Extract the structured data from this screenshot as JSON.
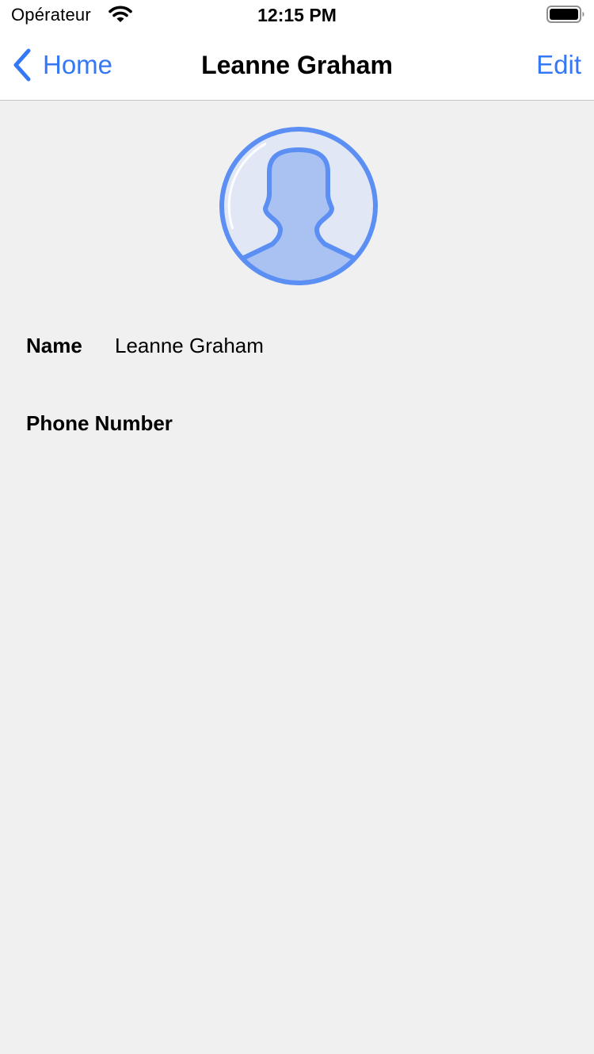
{
  "status_bar": {
    "carrier": "Opérateur",
    "time": "12:15 PM"
  },
  "nav": {
    "back_label": "Home",
    "title": "Leanne Graham",
    "edit_label": "Edit"
  },
  "contact": {
    "name_label": "Name",
    "name_value": "Leanne Graham",
    "phone_label": "Phone Number",
    "phone_value": ""
  },
  "colors": {
    "accent": "#3478f6",
    "background": "#f0f0f0",
    "avatar_ring": "#5b8ff3",
    "avatar_fill": "#e1e7f4",
    "avatar_silhouette": "#a9c2f1"
  },
  "icons": {
    "wifi": "wifi-icon",
    "battery": "battery-icon",
    "back": "chevron-left-icon",
    "avatar": "person-silhouette-icon"
  }
}
